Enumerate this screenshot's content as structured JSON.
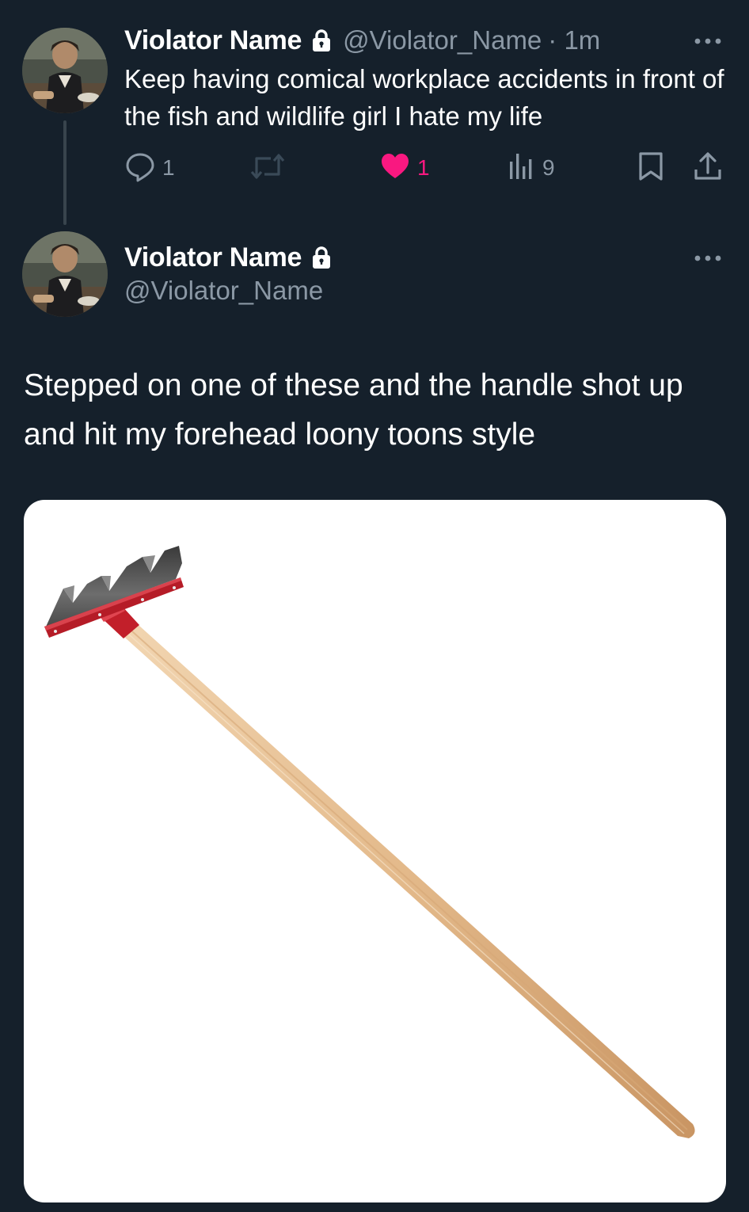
{
  "thread": {
    "parent_tweet": {
      "author": {
        "display_name": "Violator Name",
        "handle": "@Violator_Name",
        "protected_icon": "lock-icon",
        "avatar_icon": "avatar"
      },
      "timestamp": "· 1m",
      "text": "Keep having comical workplace accidents in front of the fish and wildlife girl I hate my life",
      "actions": {
        "replies": "1",
        "retweets": "",
        "likes": "1",
        "views": "9"
      },
      "icons": {
        "reply": "reply-icon",
        "retweet": "retweet-icon",
        "like": "heart-filled-icon",
        "views": "views-icon",
        "bookmark": "bookmark-icon",
        "share": "share-icon",
        "more": "more-icon"
      }
    },
    "focused_tweet": {
      "author": {
        "display_name": "Violator Name",
        "handle": "@Violator_Name",
        "protected_icon": "lock-icon"
      },
      "text": "Stepped on one of these and the handle shot up and hit my forehead loony toons style",
      "media": {
        "type": "image",
        "subject": "rake"
      }
    }
  },
  "colors": {
    "background": "#15202b",
    "text_primary": "#ffffff",
    "text_secondary": "#8b98a5",
    "like_active": "#f91880",
    "thread_line": "#38444d",
    "media_background": "#ffffff"
  }
}
